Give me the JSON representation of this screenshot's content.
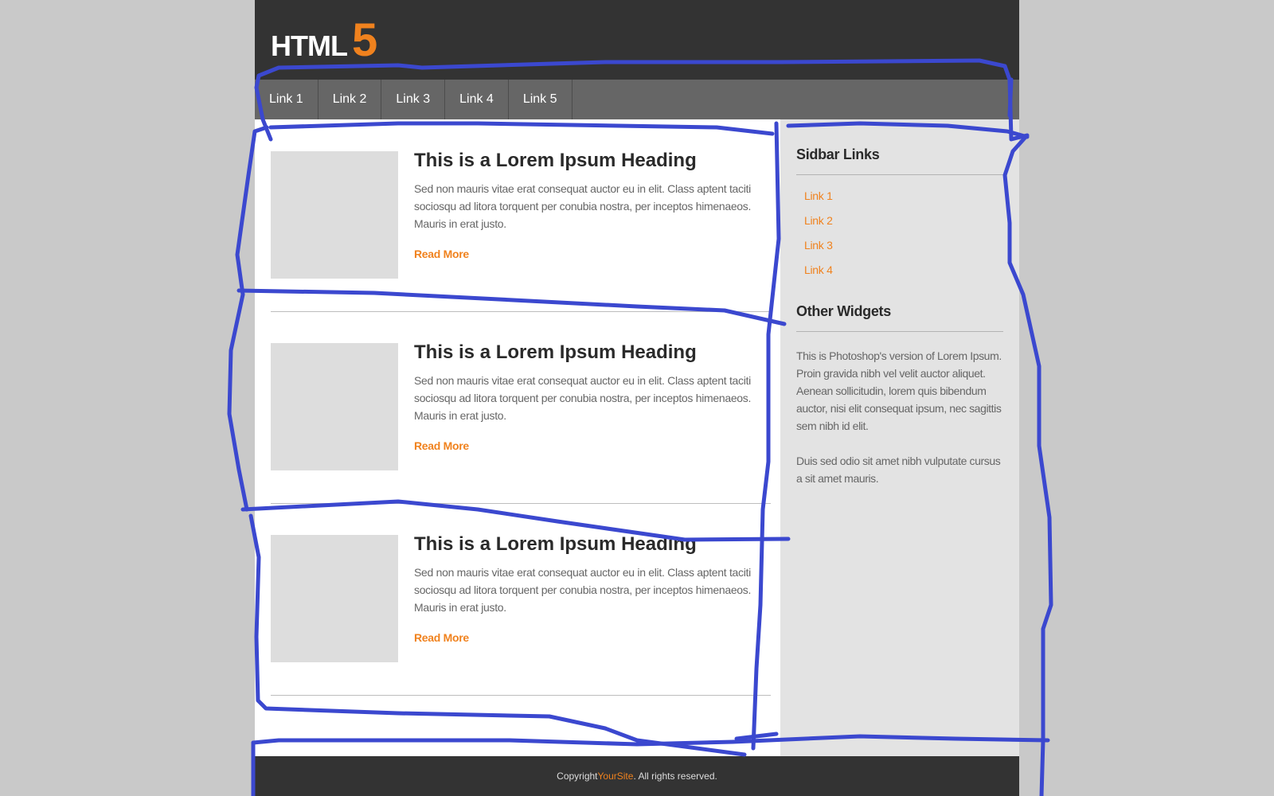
{
  "header": {
    "logo_text": "HTML",
    "logo_number": "5"
  },
  "nav": {
    "items": [
      "Link 1",
      "Link 2",
      "Link 3",
      "Link 4",
      "Link 5"
    ]
  },
  "articles": [
    {
      "heading": "This is a Lorem Ipsum  Heading",
      "body": "Sed non  mauris vitae erat consequat auctor eu in elit. Class aptent taciti sociosqu ad litora torquent per conubia nostra, per inceptos himenaeos. Mauris in erat justo.",
      "read_more": "Read More"
    },
    {
      "heading": "This is a Lorem Ipsum  Heading",
      "body": "Sed non  mauris vitae erat consequat auctor eu in elit. Class aptent taciti sociosqu ad litora torquent per conubia nostra, per inceptos himenaeos. Mauris in erat justo.",
      "read_more": "Read More"
    },
    {
      "heading": "This is a Lorem Ipsum  Heading",
      "body": "Sed non  mauris vitae erat consequat auctor eu in elit. Class aptent taciti sociosqu ad litora torquent per conubia nostra, per inceptos himenaeos. Mauris in erat justo.",
      "read_more": "Read More"
    }
  ],
  "sidebar": {
    "links_heading": "Sidbar Links",
    "links": [
      "Link 1",
      "Link 2",
      "Link 3",
      "Link 4"
    ],
    "widgets_heading": "Other Widgets",
    "widget_text_1": "This is Photoshop's version  of Lorem Ipsum. Proin gravida nibh vel velit auctor aliquet. Aenean sollicitudin, lorem quis bibendum auctor, nisi elit consequat ipsum, nec sagittis sem nibh id elit.",
    "widget_text_2": "Duis sed odio sit amet nibh vulputate cursus a sit amet mauris."
  },
  "footer": {
    "prefix": "Copyright ",
    "brand": "YourSite",
    "suffix": ". All rights reserved."
  },
  "colors": {
    "accent": "#f0821e",
    "header_bg": "#333333",
    "nav_bg": "#666666",
    "sidebar_bg": "#e3e3e3",
    "outside_bg": "#c9c9c9",
    "annotation": "#3b48cf"
  }
}
